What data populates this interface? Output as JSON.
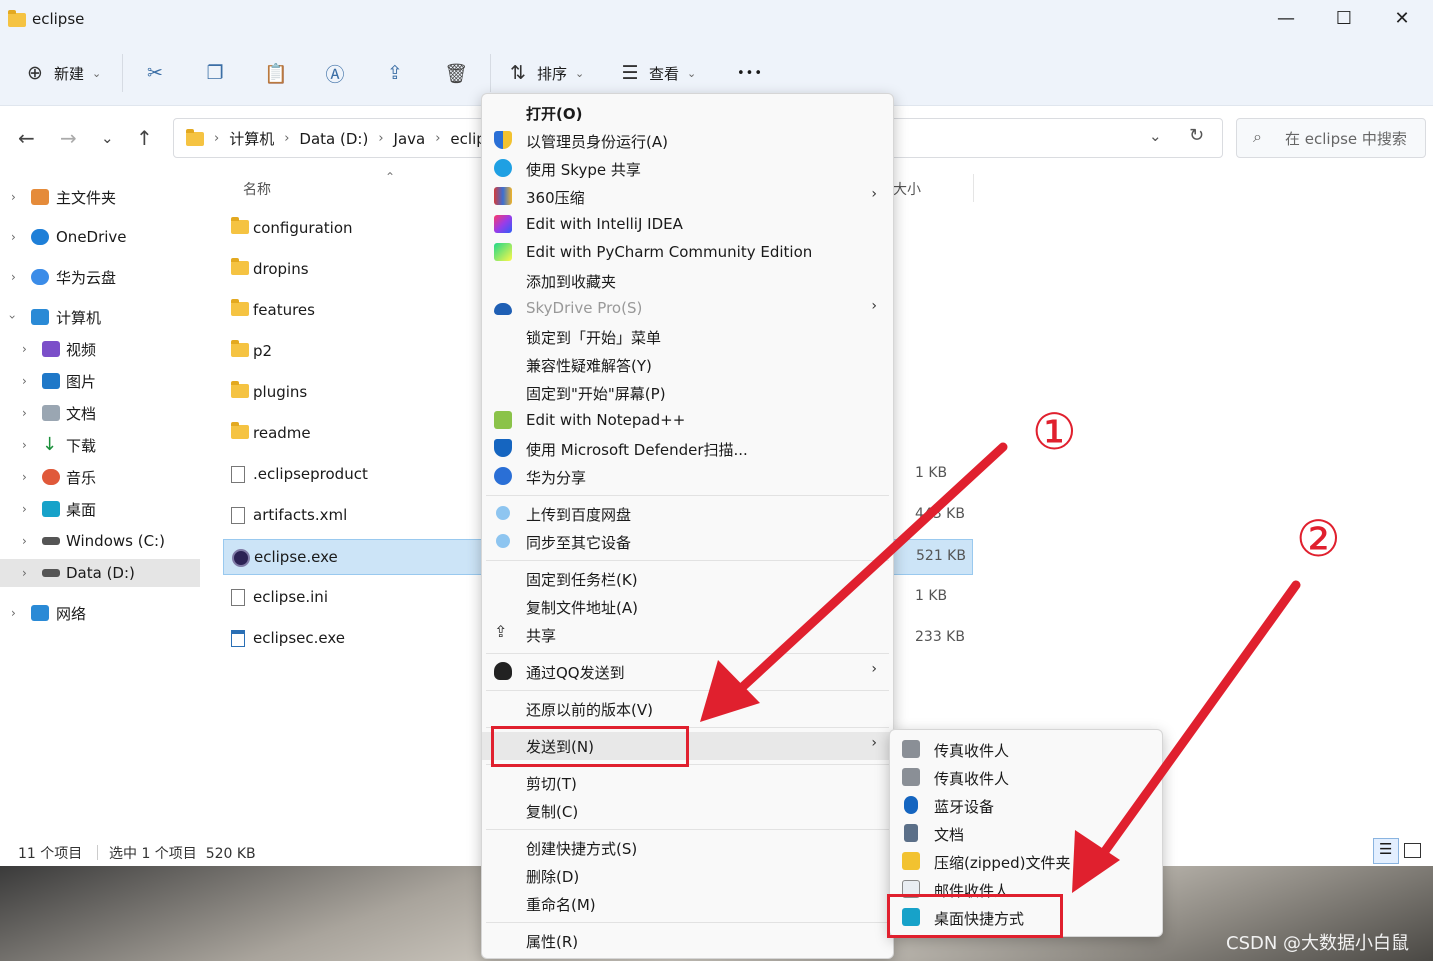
{
  "window": {
    "title": "eclipse",
    "controls": [
      "—",
      "☐",
      "✕"
    ]
  },
  "toolbar": {
    "new_label": "新建",
    "sort_label": "排序",
    "view_label": "查看",
    "more_label": "•••"
  },
  "address": {
    "crumbs": [
      "计算机",
      "Data (D:)",
      "Java",
      "eclip"
    ]
  },
  "search": {
    "placeholder": "在 eclipse 中搜索"
  },
  "sidebar": {
    "items": [
      "主文件夹",
      "OneDrive",
      "华为云盘",
      "计算机",
      "视频",
      "图片",
      "文档",
      "下载",
      "音乐",
      "桌面",
      "Windows (C:)",
      "Data (D:)",
      "网络"
    ]
  },
  "filelist": {
    "name_header": "名称",
    "size_header": "大小",
    "rows": [
      {
        "name": "configuration",
        "size": ""
      },
      {
        "name": "dropins",
        "size": ""
      },
      {
        "name": "features",
        "size": ""
      },
      {
        "name": "p2",
        "size": ""
      },
      {
        "name": "plugins",
        "size": ""
      },
      {
        "name": "readme",
        "size": ""
      },
      {
        "name": ".eclipseproduct",
        "size": "1 KB"
      },
      {
        "name": "artifacts.xml",
        "size": "443 KB"
      },
      {
        "name": "eclipse.exe",
        "size": "521 KB"
      },
      {
        "name": "eclipse.ini",
        "size": "1 KB"
      },
      {
        "name": "eclipsec.exe",
        "size": "233 KB"
      }
    ]
  },
  "status": {
    "count": "11 个项目",
    "selection": "选中 1 个项目  520 KB"
  },
  "context_menu": {
    "items": [
      "打开(O)",
      "以管理员身份运行(A)",
      "使用 Skype 共享",
      "360压缩",
      "Edit with IntelliJ IDEA",
      "Edit with PyCharm Community Edition",
      "添加到收藏夹",
      "SkyDrive Pro(S)",
      "锁定到「开始」菜单",
      "兼容性疑难解答(Y)",
      "固定到\"开始\"屏幕(P)",
      "Edit with Notepad++",
      "使用 Microsoft Defender扫描...",
      "华为分享",
      "上传到百度网盘",
      "同步至其它设备",
      "固定到任务栏(K)",
      "复制文件地址(A)",
      "共享",
      "通过QQ发送到",
      "还原以前的版本(V)",
      "发送到(N)",
      "剪切(T)",
      "复制(C)",
      "创建快捷方式(S)",
      "删除(D)",
      "重命名(M)",
      "属性(R)"
    ]
  },
  "submenu": {
    "items": [
      "传真收件人",
      "传真收件人",
      "蓝牙设备",
      "文档",
      "压缩(zipped)文件夹",
      "邮件收件人",
      "桌面快捷方式"
    ]
  },
  "annotations": {
    "one": "①",
    "two": "②",
    "color": "#e0202e"
  },
  "watermark": "CSDN @大数据小白鼠"
}
